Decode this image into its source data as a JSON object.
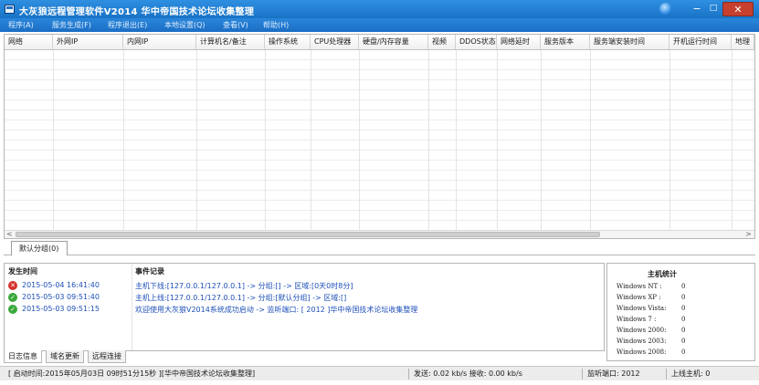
{
  "window": {
    "title": "大灰狼远程管理软件V2014  华中帝国技术论坛收集整理",
    "minimize": "−",
    "maximize": "□",
    "close": "✕"
  },
  "menu": [
    "程序(A)",
    "服务生成(F)",
    "程序退出(E)",
    "本地设置(Q)",
    "查看(V)",
    "帮助(H)"
  ],
  "grid": {
    "columns": [
      "网络",
      "外网IP",
      "内网IP",
      "计算机名/备注",
      "操作系统",
      "CPU处理器",
      "硬盘/内存容量",
      "视频",
      "DDOS状态",
      "网络延时",
      "服务版本",
      "服务端安装时间",
      "开机运行时间",
      "地理"
    ]
  },
  "scroll": {
    "left_arrow": "<",
    "right_arrow": ">"
  },
  "group_tab": "默认分组(0)",
  "log": {
    "headers": {
      "time": "发生时间",
      "event": "事件记录"
    },
    "rows": [
      {
        "status": "error",
        "time": "2015-05-04 16:41:40",
        "event": "主机下线:[127.0.0.1/127.0.0.1] -> 分组:[] -> 区域:[0天0时8分]"
      },
      {
        "status": "ok",
        "time": "2015-05-03 09:51:40",
        "event": "主机上线:[127.0.0.1/127.0.0.1] -> 分组:[默认分组] -> 区域:[]"
      },
      {
        "status": "ok",
        "time": "2015-05-03 09:51:15",
        "event": "欢迎使用大灰狼V2014系统成功启动 -> 监听端口: [ 2012 ]华中帝国技术论坛收集整理"
      }
    ]
  },
  "host_stats": {
    "title": "主机统计",
    "rows": [
      {
        "label": "Windows NT :",
        "value": "0"
      },
      {
        "label": "Windows XP :",
        "value": "0"
      },
      {
        "label": "Windows Vista:",
        "value": "0"
      },
      {
        "label": "Windows 7 :",
        "value": "0"
      },
      {
        "label": "Windows 2000:",
        "value": "0"
      },
      {
        "label": "Windows 2003:",
        "value": "0"
      },
      {
        "label": "Windows 2008:",
        "value": "0"
      }
    ]
  },
  "bottom_tabs": [
    "日志信息",
    "域名更新",
    "远程连接"
  ],
  "status": {
    "start_time": "[ 启动时间:2015年05月03日 09时51分15秒 ][华中帝国技术论坛收集整理]",
    "traffic": "发送: 0.02 kb/s 接收: 0.00 kb/s",
    "port": "监听端口: 2012",
    "online": "上线主机: 0"
  },
  "colors": {
    "titlebar": "#1e7ad0",
    "close": "#c7402e",
    "log_text": "#1d4fb8",
    "ok_icon": "#3aa93a",
    "error_icon": "#d4322b"
  }
}
